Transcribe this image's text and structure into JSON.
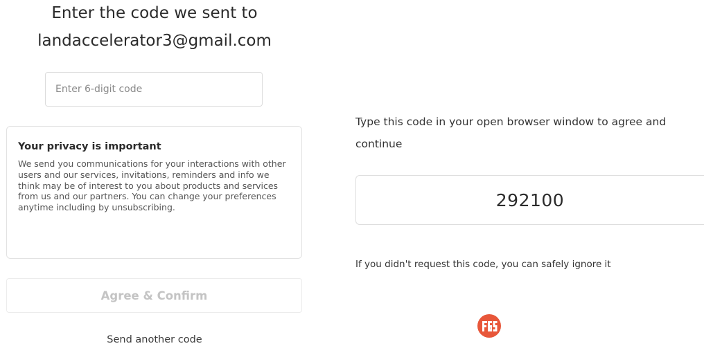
{
  "left": {
    "heading_line1": "Enter the code we sent to",
    "heading_line2": "landaccelerator3@gmail.com",
    "code_input": {
      "placeholder": "Enter 6-digit code",
      "value": ""
    },
    "privacy": {
      "title": "Your privacy is important",
      "body": "We send you communications for your interactions with other users and our services, invitations, reminders and info we think may be of interest to you about products and services from us and our partners. You can change your preferences anytime including by unsubscribing."
    },
    "agree_button_label": "Agree & Confirm",
    "send_another_label": "Send another code"
  },
  "right": {
    "instruction": "Type this code in your open browser window to agree and continue",
    "code": "292100",
    "ignore_note": "If you didn't request this code, you can safely ignore it",
    "logo": {
      "text": "F6S",
      "icon": "f6s-logo-icon",
      "color": "#e8573a"
    }
  }
}
